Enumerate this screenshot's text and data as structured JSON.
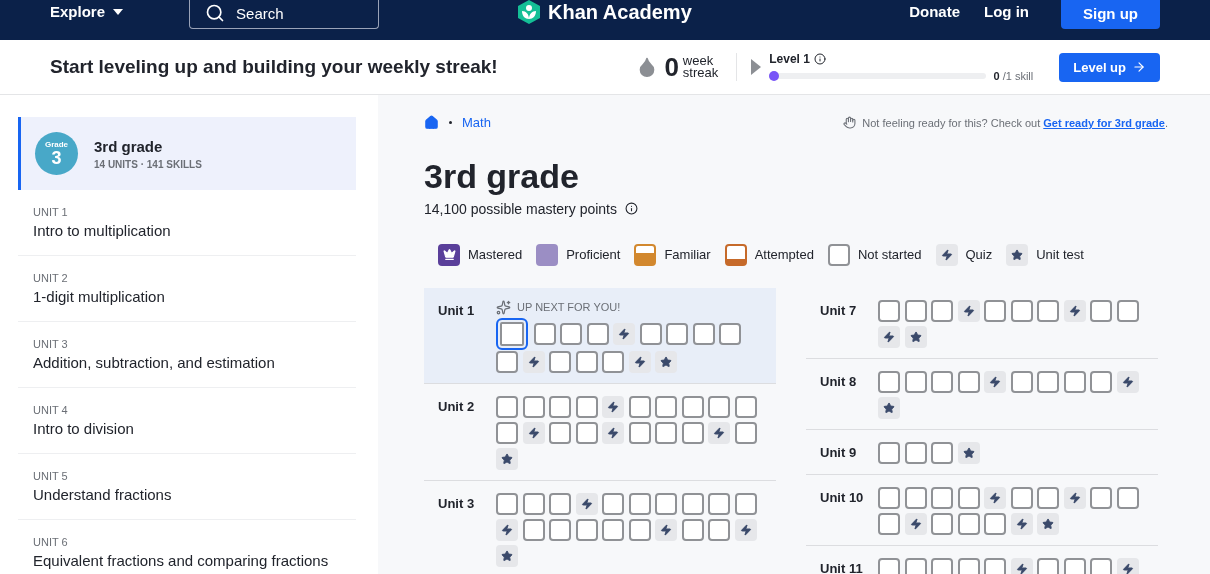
{
  "nav": {
    "explore": "Explore",
    "search_placeholder": "Search",
    "logo": "Khan Academy",
    "links": [
      "Donate",
      "Log in"
    ],
    "signup": "Sign up"
  },
  "streak_bar": {
    "message": "Start leveling up and building your weekly streak!",
    "streak_count": "0",
    "streak_label_top": "week",
    "streak_label_bottom": "streak",
    "level_label": "Level 1",
    "level": 0,
    "progress_value": "0",
    "progress_total": "/1 skill",
    "button": "Level up"
  },
  "sidebar": {
    "course": {
      "badge_top": "Grade",
      "badge_number": "3",
      "title": "3rd grade",
      "meta": "14 UNITS · 141 SKILLS",
      "selected": true
    },
    "units": [
      {
        "label": "UNIT 1",
        "title": "Intro to multiplication",
        "selected": false
      },
      {
        "label": "UNIT 2",
        "title": "1-digit multiplication",
        "selected": false
      },
      {
        "label": "UNIT 3",
        "title": "Addition, subtraction, and estimation",
        "selected": false
      },
      {
        "label": "UNIT 4",
        "title": "Intro to division",
        "selected": false
      },
      {
        "label": "UNIT 5",
        "title": "Understand fractions",
        "selected": false
      },
      {
        "label": "UNIT 6",
        "title": "Equivalent fractions and comparing fractions",
        "selected": false
      }
    ]
  },
  "content": {
    "breadcrumb": [
      "Math"
    ],
    "notice": "Not feeling ready for this? Check out ",
    "notice_link": "Get ready for 3rd grade",
    "notice_end": ".",
    "title": "3rd grade",
    "subtitle": "14,100 possible mastery points",
    "legend": [
      {
        "kind": "mastered",
        "label": "Mastered"
      },
      {
        "kind": "proficient",
        "label": "Proficient"
      },
      {
        "kind": "familiar",
        "label": "Familiar"
      },
      {
        "kind": "attempted",
        "label": "Attempted"
      },
      {
        "kind": "not_started",
        "label": "Not started"
      },
      {
        "kind": "quiz",
        "label": "Quiz"
      },
      {
        "kind": "unit_test",
        "label": "Unit test"
      }
    ],
    "unit_columns": [
      [
        {
          "name": "Unit 1",
          "highlighted": true,
          "up_next": "UP NEXT FOR YOU!",
          "skills": [
            {
              "kind": "next"
            },
            {
              "kind": "skill"
            },
            {
              "kind": "skill"
            },
            {
              "kind": "skill"
            },
            {
              "kind": "quiz"
            },
            {
              "kind": "skill"
            },
            {
              "kind": "skill"
            },
            {
              "kind": "skill"
            },
            {
              "kind": "skill"
            },
            {
              "kind": "skill"
            },
            {
              "kind": "quiz"
            },
            {
              "kind": "skill"
            },
            {
              "kind": "skill"
            },
            {
              "kind": "skill"
            },
            {
              "kind": "quiz"
            },
            {
              "kind": "test"
            }
          ]
        },
        {
          "name": "Unit 2",
          "highlighted": false,
          "skills": [
            {
              "kind": "skill"
            },
            {
              "kind": "skill"
            },
            {
              "kind": "skill"
            },
            {
              "kind": "skill"
            },
            {
              "kind": "quiz"
            },
            {
              "kind": "skill"
            },
            {
              "kind": "skill"
            },
            {
              "kind": "skill"
            },
            {
              "kind": "skill"
            },
            {
              "kind": "skill"
            },
            {
              "kind": "skill"
            },
            {
              "kind": "quiz"
            },
            {
              "kind": "skill"
            },
            {
              "kind": "skill"
            },
            {
              "kind": "quiz"
            },
            {
              "kind": "skill"
            },
            {
              "kind": "skill"
            },
            {
              "kind": "skill"
            },
            {
              "kind": "quiz"
            },
            {
              "kind": "skill"
            },
            {
              "kind": "test"
            }
          ]
        },
        {
          "name": "Unit 3",
          "highlighted": false,
          "skills": [
            {
              "kind": "skill"
            },
            {
              "kind": "skill"
            },
            {
              "kind": "skill"
            },
            {
              "kind": "quiz"
            },
            {
              "kind": "skill"
            },
            {
              "kind": "skill"
            },
            {
              "kind": "skill"
            },
            {
              "kind": "skill"
            },
            {
              "kind": "skill"
            },
            {
              "kind": "skill"
            },
            {
              "kind": "quiz"
            },
            {
              "kind": "skill"
            },
            {
              "kind": "skill"
            },
            {
              "kind": "skill"
            },
            {
              "kind": "skill"
            },
            {
              "kind": "skill"
            },
            {
              "kind": "quiz"
            },
            {
              "kind": "skill"
            },
            {
              "kind": "skill"
            },
            {
              "kind": "quiz"
            },
            {
              "kind": "test"
            }
          ]
        }
      ],
      [
        {
          "name": "Unit 7",
          "highlighted": false,
          "skills": [
            {
              "kind": "skill"
            },
            {
              "kind": "skill"
            },
            {
              "kind": "skill"
            },
            {
              "kind": "quiz"
            },
            {
              "kind": "skill"
            },
            {
              "kind": "skill"
            },
            {
              "kind": "skill"
            },
            {
              "kind": "quiz"
            },
            {
              "kind": "skill"
            },
            {
              "kind": "skill"
            },
            {
              "kind": "quiz"
            },
            {
              "kind": "test"
            }
          ]
        },
        {
          "name": "Unit 8",
          "highlighted": false,
          "skills": [
            {
              "kind": "skill"
            },
            {
              "kind": "skill"
            },
            {
              "kind": "skill"
            },
            {
              "kind": "skill"
            },
            {
              "kind": "quiz"
            },
            {
              "kind": "skill"
            },
            {
              "kind": "skill"
            },
            {
              "kind": "skill"
            },
            {
              "kind": "skill"
            },
            {
              "kind": "quiz"
            },
            {
              "kind": "test"
            }
          ]
        },
        {
          "name": "Unit 9",
          "highlighted": false,
          "skills": [
            {
              "kind": "skill"
            },
            {
              "kind": "skill"
            },
            {
              "kind": "skill"
            },
            {
              "kind": "test"
            }
          ]
        },
        {
          "name": "Unit 10",
          "highlighted": false,
          "skills": [
            {
              "kind": "skill"
            },
            {
              "kind": "skill"
            },
            {
              "kind": "skill"
            },
            {
              "kind": "skill"
            },
            {
              "kind": "quiz"
            },
            {
              "kind": "skill"
            },
            {
              "kind": "skill"
            },
            {
              "kind": "quiz"
            },
            {
              "kind": "skill"
            },
            {
              "kind": "skill"
            },
            {
              "kind": "skill"
            },
            {
              "kind": "quiz"
            },
            {
              "kind": "skill"
            },
            {
              "kind": "skill"
            },
            {
              "kind": "skill"
            },
            {
              "kind": "quiz"
            },
            {
              "kind": "test"
            }
          ]
        },
        {
          "name": "Unit 11",
          "highlighted": false,
          "skills": [
            {
              "kind": "skill"
            },
            {
              "kind": "skill"
            },
            {
              "kind": "skill"
            },
            {
              "kind": "skill"
            },
            {
              "kind": "skill"
            },
            {
              "kind": "quiz"
            },
            {
              "kind": "skill"
            },
            {
              "kind": "skill"
            },
            {
              "kind": "skill"
            },
            {
              "kind": "quiz"
            }
          ]
        }
      ]
    ]
  }
}
